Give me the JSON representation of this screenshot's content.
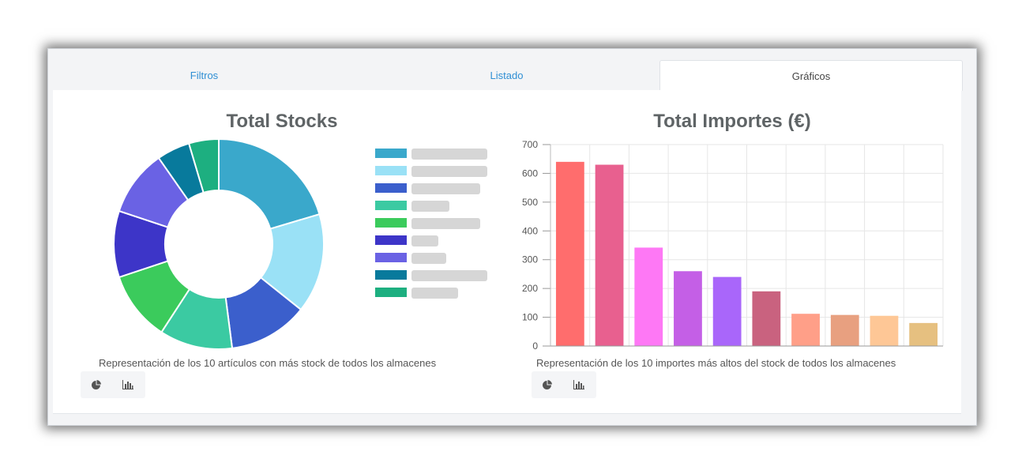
{
  "tabs": [
    {
      "label": "Filtros",
      "active": false
    },
    {
      "label": "Listado",
      "active": false
    },
    {
      "label": "Gráficos",
      "active": true
    }
  ],
  "charts": {
    "stocks": {
      "caption": "Representación de los 10 artículos con más stock de todos los almacenes"
    },
    "importes": {
      "caption": "Representación de los 10 importes más altos del stock de todos los almacenes"
    }
  },
  "icons": {
    "pie": "pie-chart-icon",
    "bar": "bar-chart-icon"
  },
  "chart_data": [
    {
      "type": "pie",
      "variant": "doughnut",
      "title": "Total Stocks",
      "values": [
        20,
        15,
        12,
        11,
        10.5,
        10,
        10,
        5,
        4.5
      ],
      "colors": [
        "#3aa8cb",
        "#9ae1f6",
        "#3b5fcc",
        "#3bcaa2",
        "#3bcb5c",
        "#3d35c8",
        "#6a62e4",
        "#087a9c",
        "#1daf80"
      ],
      "legend_placement": "right",
      "legend_label_widths": [
        96,
        96,
        87,
        48,
        87,
        34,
        44,
        96,
        59
      ]
    },
    {
      "type": "bar",
      "title": "Total Importes (€)",
      "values": [
        640,
        630,
        342,
        260,
        240,
        190,
        112,
        108,
        105,
        80
      ],
      "colors": [
        "#ff6d6d",
        "#e8608f",
        "#fe78f5",
        "#c45fe6",
        "#a966fa",
        "#c9627f",
        "#ff9f88",
        "#e8a080",
        "#fec796",
        "#e6c080"
      ],
      "ylim": [
        0,
        700
      ],
      "yticks": [
        0,
        100,
        200,
        300,
        400,
        500,
        600,
        700
      ],
      "grid": true
    }
  ]
}
